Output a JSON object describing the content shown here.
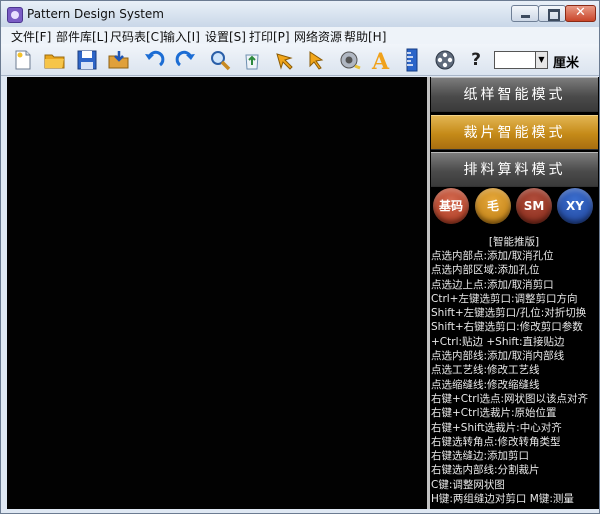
{
  "window": {
    "title": "Pattern Design System"
  },
  "menu": [
    "文件[F]",
    "部件库[L]",
    "尺码表[C]",
    "输入[I]",
    "设置[S]",
    "打印[P]",
    "网络资源",
    "帮助[H]"
  ],
  "toolbar": {
    "icons": [
      "new-file-icon",
      "open-folder-icon",
      "save-icon",
      "import-icon",
      "undo-icon",
      "redo-icon",
      "zoom-icon",
      "recycle-icon",
      "select-arrow-icon",
      "pointer-icon",
      "tape-measure-icon",
      "text-icon",
      "ruler-icon",
      "film-reel-icon",
      "help-icon"
    ],
    "help_label": "?",
    "unit_value": "",
    "unit_label": "厘米"
  },
  "panel": {
    "modes": [
      "纸样智能模式",
      "裁片智能模式",
      "排料算料模式"
    ],
    "circles": [
      "基码",
      "毛",
      "SM",
      "XY"
    ],
    "help_title": "[智能推版]",
    "help_lines": [
      "点选内部点:添加/取消孔位",
      "点选内部区域:添加孔位",
      "点选边上点:添加/取消剪口",
      "Ctrl+左键选剪口:调整剪口方向",
      "Shift+左键选剪口/孔位:对折切换",
      "Shift+右键选剪口:修改剪口参数",
      " +Ctrl:贴边 +Shift:直接贴边",
      "点选内部线:添加/取消内部线",
      "点选工艺线:修改工艺线",
      "点选缩缝线:修改缩缝线",
      "右键+Ctrl选点:网状图以该点对齐",
      "右键+Ctrl选裁片:原始位置",
      "右键+Shift选裁片:中心对齐",
      "右键选转角点:修改转角类型",
      "右键选缝边:添加剪口",
      "右键选内部线:分割裁片",
      "C键:调整网状图",
      "H键:两组缝边对剪口  M键:测量"
    ]
  }
}
